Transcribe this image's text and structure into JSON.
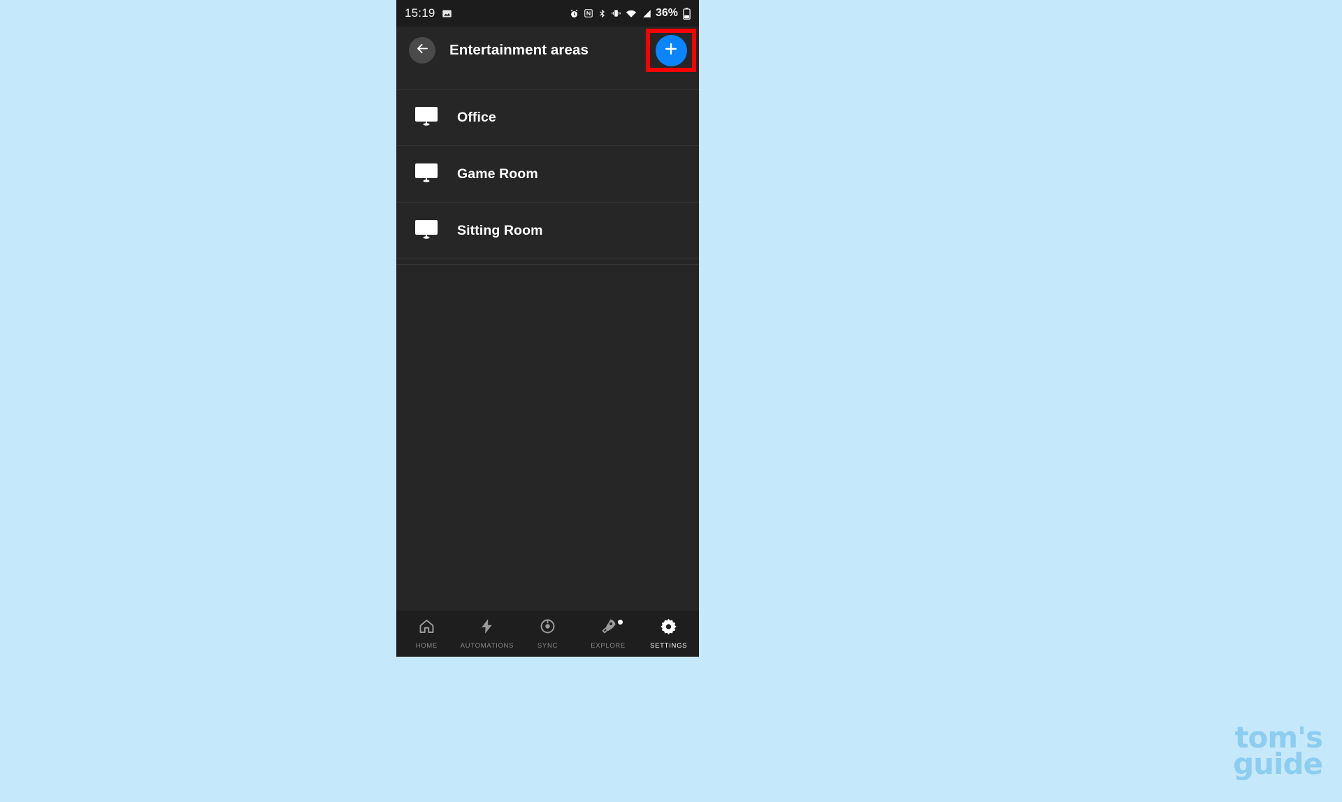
{
  "background_color": "#c5e8fa",
  "status_bar": {
    "time": "15:19",
    "battery_percent": "36%",
    "icons": [
      "image-icon",
      "alarm-icon",
      "nfc-icon",
      "bluetooth-icon",
      "vibrate-icon",
      "wifi-icon",
      "cellular-signal-icon",
      "battery-icon"
    ]
  },
  "header": {
    "back_label": "Back",
    "title": "Entertainment areas",
    "add_button_label": "+",
    "add_button_color": "#0a84ff",
    "highlight_color": "#ff0000"
  },
  "list": {
    "items": [
      {
        "label": "Office",
        "icon": "monitor-icon"
      },
      {
        "label": "Game Room",
        "icon": "monitor-icon"
      },
      {
        "label": "Sitting Room",
        "icon": "monitor-icon"
      }
    ]
  },
  "bottom_nav": {
    "items": [
      {
        "label": "HOME",
        "icon": "home-icon",
        "active": false,
        "badge": false
      },
      {
        "label": "AUTOMATIONS",
        "icon": "lightning-icon",
        "active": false,
        "badge": false
      },
      {
        "label": "SYNC",
        "icon": "sync-icon",
        "active": false,
        "badge": false
      },
      {
        "label": "EXPLORE",
        "icon": "rocket-icon",
        "active": false,
        "badge": true
      },
      {
        "label": "SETTINGS",
        "icon": "gear-icon",
        "active": true,
        "badge": false
      }
    ]
  },
  "watermark": {
    "line1": "tom's",
    "line2": "guide"
  }
}
